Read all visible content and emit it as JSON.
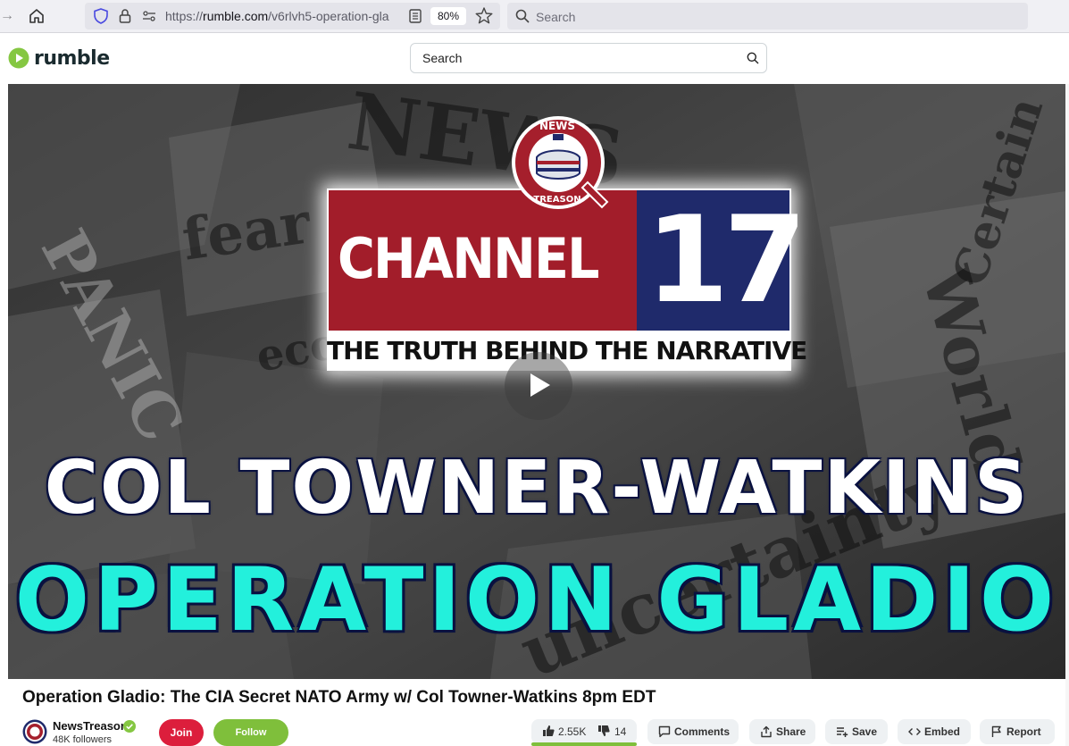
{
  "browser": {
    "url_prefix": "https://",
    "url_domain": "rumble.com",
    "url_path": "/v6rlvh5-operation-gla",
    "zoom": "80%",
    "search_placeholder": "Search"
  },
  "site": {
    "logo_text": "rumble",
    "search_placeholder": "Search",
    "brand_color": "#85c742"
  },
  "thumbnail": {
    "badge_top": "NEWS",
    "badge_bottom": "TREASON",
    "channel_word": "CHANNEL",
    "channel_number": "17",
    "tagline": "THE TRUTH BEHIND THE NARRATIVE",
    "headline_1": "COL TOWNER-WATKINS",
    "headline_2": "OPERATION GLADIO",
    "background_words": [
      "NEWS",
      "fear",
      "PANIC",
      "eco",
      "Certain",
      "World",
      "uncertainty"
    ]
  },
  "video": {
    "title": "Operation Gladio: The CIA Secret NATO Army w/ Col Towner-Watkins 8pm EDT"
  },
  "channel": {
    "name": "NewsTreason",
    "followers": "48K followers",
    "join_label": "Join",
    "follow_label": "Follow"
  },
  "actions": {
    "likes": "2.55K",
    "dislikes": "14",
    "comments_label": "Comments",
    "share_label": "Share",
    "save_label": "Save",
    "embed_label": "Embed",
    "report_label": "Report"
  }
}
